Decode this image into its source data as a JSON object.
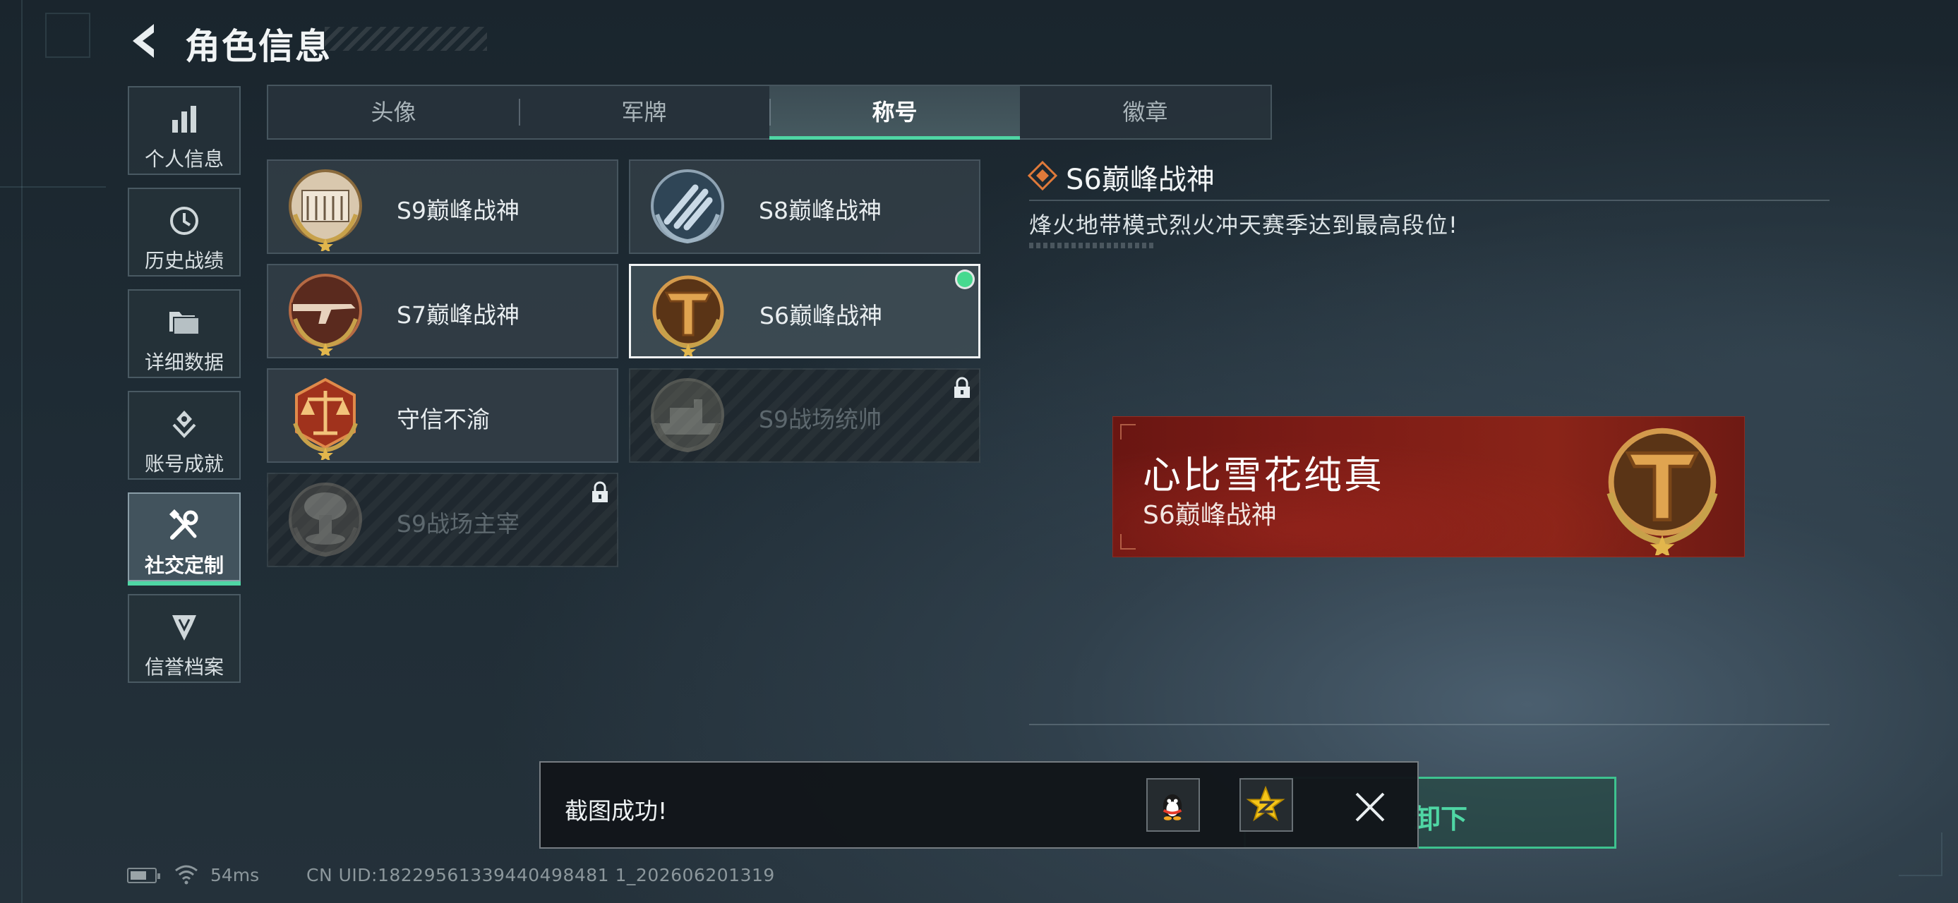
{
  "header": {
    "title": "角色信息"
  },
  "sidebar": {
    "items": [
      {
        "label": "个人信息",
        "icon": "bar-chart-icon"
      },
      {
        "label": "历史战绩",
        "icon": "history-clock-icon"
      },
      {
        "label": "详细数据",
        "icon": "folder-icon"
      },
      {
        "label": "账号成就",
        "icon": "achievement-icon"
      },
      {
        "label": "社交定制",
        "icon": "tools-icon",
        "active": true
      },
      {
        "label": "信誉档案",
        "icon": "credit-shield-icon"
      }
    ]
  },
  "tabs": [
    {
      "label": "头像"
    },
    {
      "label": "军牌"
    },
    {
      "label": "称号",
      "active": true
    },
    {
      "label": "徽章"
    }
  ],
  "titles": [
    {
      "name": "S9巅峰战神",
      "locked": false,
      "icon": "fortress-emblem-icon"
    },
    {
      "name": "S8巅峰战神",
      "locked": false,
      "icon": "blue-stripes-emblem-icon"
    },
    {
      "name": "S7巅峰战神",
      "locked": false,
      "icon": "rifle-emblem-icon"
    },
    {
      "name": "S6巅峰战神",
      "locked": false,
      "selected": true,
      "icon": "t-shield-emblem-icon"
    },
    {
      "name": "守信不渝",
      "locked": false,
      "icon": "scales-emblem-icon"
    },
    {
      "name": "S9战场统帅",
      "locked": true,
      "icon": "warship-emblem-icon"
    },
    {
      "name": "S9战场主宰",
      "locked": true,
      "icon": "mushroom-cloud-emblem-icon"
    }
  ],
  "detail": {
    "title": "S6巅峰战神",
    "description": "烽火地带模式烈火冲天赛季达到最高段位!"
  },
  "nameplate": {
    "player_name": "心比雪花纯真",
    "title": "S6巅峰战神"
  },
  "toast": {
    "text": "截图成功!",
    "share_qq_icon": "qq-penguin-icon",
    "share_qzone_icon": "qzone-star-icon"
  },
  "action_button": {
    "label": "卸下"
  },
  "status": {
    "ping": "54ms",
    "uid": "CN UID:18229561339440498481 1_202606201319"
  },
  "colors": {
    "accent_green": "#4fd6a4",
    "selected_dot": "#47d98f",
    "nameplate_red": "#7d1c16"
  }
}
